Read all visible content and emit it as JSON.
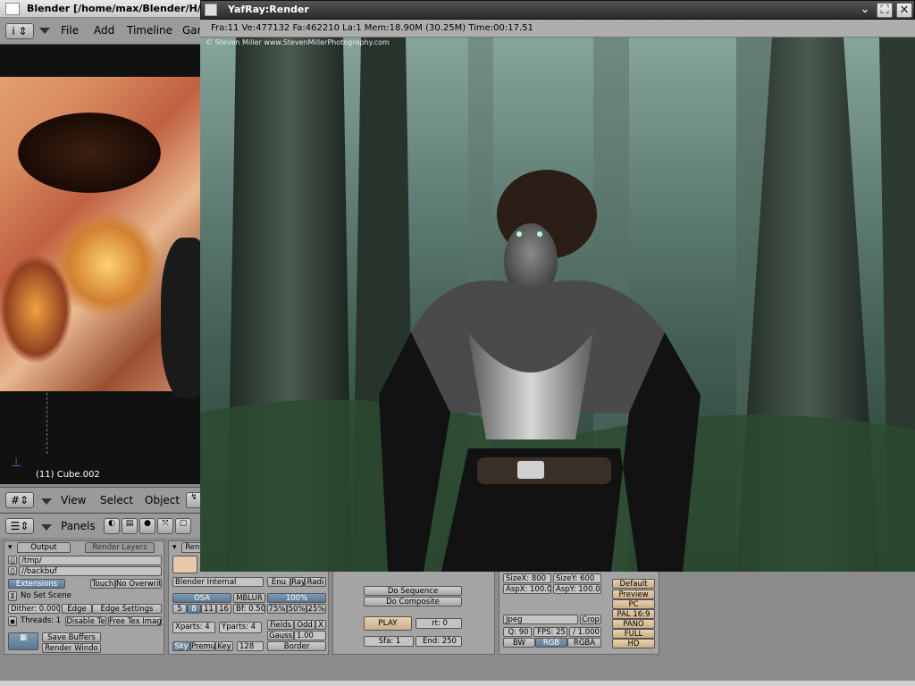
{
  "blender": {
    "title": "Blender [/home/max/Blender/H/C/(",
    "menus": [
      "File",
      "Add",
      "Timeline",
      "Gar"
    ],
    "viewport_label": "(11) Cube.002",
    "view_header": [
      "View",
      "Select",
      "Object"
    ],
    "panels_label": "Panels",
    "output_tab": "Output",
    "render_layers_tab": "Render Layers",
    "render_tab": "Rend",
    "path_tmp": "/tmp/",
    "path_backbuf": "//backbuf",
    "extensions": "Extensions",
    "touch": "Touch",
    "no_overwrite": "No Overwrite",
    "no_set_scene": "No Set Scene",
    "dither": "Dither: 0.000",
    "edge": "Edge",
    "edge_settings": "Edge Settings",
    "threads": "Threads: 1",
    "disable_te": "Disable Te",
    "free_tex_image": "Free Tex Image",
    "save_buffers": "Save Buffers",
    "render_window": "Render Windo",
    "renderer": "Blender Internal",
    "enum_partial": "Enu",
    "ray_partial": "Ray",
    "radi_partial": "Radi",
    "osa": "OSA",
    "mblur": "MBLUR",
    "osa_levels": [
      "5",
      "8",
      "11",
      "16"
    ],
    "bf": "Bf: 0.50",
    "pct_100": "100%",
    "pct_75": "75%",
    "pct_50": "50%",
    "pct_25": "25%",
    "xparts": "Xparts: 4",
    "yparts": "Yparts: 4",
    "fields": "Fields",
    "odd": "Odd",
    "x": "X",
    "gauss": "Gauss",
    "gauss_val": "1.00",
    "sky": "Sky",
    "premul": "Premul",
    "key": "Key",
    "samples": "128",
    "border": "Border",
    "do_sequence": "Do Sequence",
    "do_composite": "Do Composite",
    "play": "PLAY",
    "rt": "rt: 0",
    "sfra": "Sfa: 1",
    "efra": "End: 250",
    "sizex": "SizeX: 800",
    "sizey": "SizeY: 600",
    "aspx": "AspX: 100.00",
    "aspy": "AspY: 100.00",
    "format": "Jpeg",
    "crop": "Crop",
    "quality": "Q: 90",
    "fps": "FPS: 25",
    "fps_base": "/ 1.000",
    "bw": "BW",
    "rgb": "RGB",
    "rgba": "RGBA",
    "presets": [
      "Default",
      "Preview",
      "PC",
      "PAL 16:9",
      "PANO",
      "FULL",
      "HD"
    ]
  },
  "yafray": {
    "title": "YafRay:Render",
    "info": "Fra:11  Ve:477132 Fa:462210 La:1 Mem:18.90M (30.25M) Time:00:17.51",
    "copyright": "© Steven Miller www.StevenMillerPhotography.com",
    "window_buttons": [
      "⌄",
      "⛶",
      "✕"
    ]
  },
  "colors": {
    "yafray_title_bg": "#2a2a2a",
    "blender_panel_bg": "#a4a4a4",
    "accent_selected": "#5a7893",
    "play_button": "#e8d2b0"
  }
}
